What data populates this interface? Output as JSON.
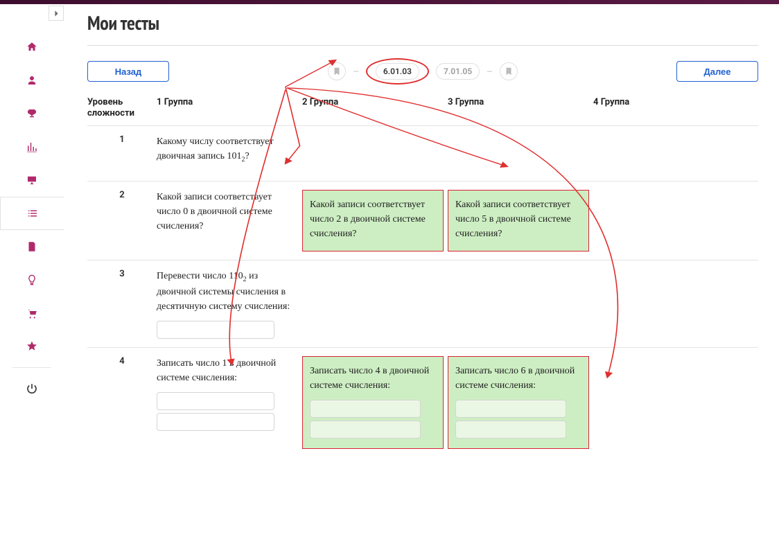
{
  "page": {
    "title": "Мои тесты"
  },
  "toolbar": {
    "back_label": "Назад",
    "next_label": "Далее",
    "crumb_current": "6.01.03",
    "crumb_next": "7.01.05"
  },
  "headers": {
    "level": "Уровень сложности",
    "g1": "1 Группа",
    "g2": "2 Группа",
    "g3": "3 Группа",
    "g4": "4 Группа"
  },
  "rows": [
    {
      "level": "1",
      "cells": {
        "g1": {
          "text": "Какому числу соответствует двоичная запись ",
          "math": "101",
          "sub": "2",
          "trail": "?"
        }
      }
    },
    {
      "level": "2",
      "cells": {
        "g1": {
          "pre": " Какой записи  соответствует число ",
          "math": "0",
          "post": " в двоичной системе счисления?"
        },
        "g2": {
          "pre": " Какой записи  соответствует число ",
          "math": "2",
          "post": " в двоичной системе счисления?",
          "highlight": true
        },
        "g3": {
          "pre": " Какой записи  соответствует число ",
          "math": "5",
          "post": " в двоичной системе счисления?",
          "highlight": true
        }
      }
    },
    {
      "level": "3",
      "cells": {
        "g1": {
          "text": "Перевести число ",
          "math": "110",
          "sub": "2",
          "trail": "  из двоичной системы счисления в десятичную систему счисления:",
          "answer": true
        }
      }
    },
    {
      "level": "4",
      "cells": {
        "g1": {
          "pre": "Записать число ",
          "math": "1",
          "post": "  в двоичной системе счисления:",
          "answer": true,
          "dbl": true
        },
        "g2": {
          "pre": "Записать число ",
          "math": "4",
          "post": "  в двоичной системе счисления:",
          "answer": true,
          "dbl": true,
          "highlight": true
        },
        "g3": {
          "pre": "Записать число ",
          "math": "6",
          "post": "  в двоичной системе счисления:",
          "answer": true,
          "dbl": true,
          "highlight": true
        }
      }
    }
  ]
}
